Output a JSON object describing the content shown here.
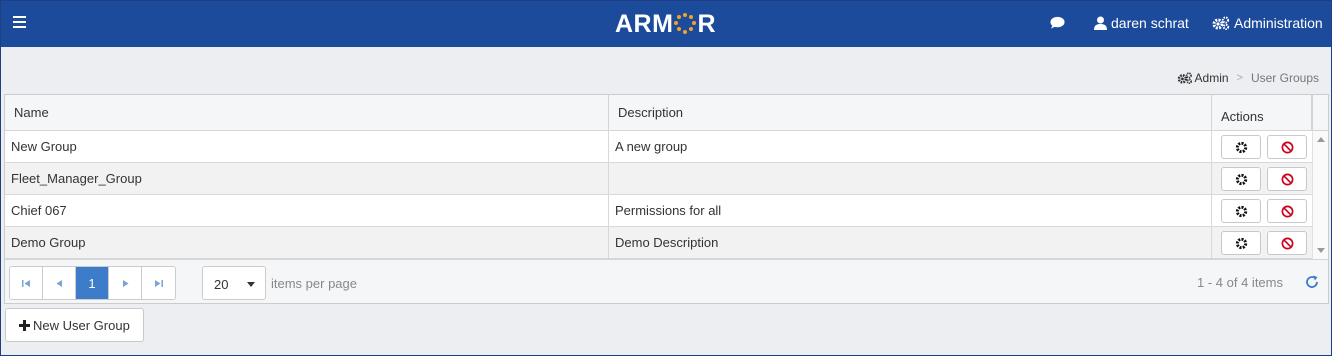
{
  "header": {
    "logo_text": "ARMOR",
    "user_name": "daren schrat",
    "admin_label": "Administration",
    "brand_color": "#1d4b9c",
    "logo_accent_color": "#f2a22b"
  },
  "breadcrumb": {
    "parent": "Admin",
    "separator": ">",
    "current": "User Groups"
  },
  "grid": {
    "columns": [
      "Name",
      "Description",
      "Actions"
    ],
    "rows": [
      {
        "name": "New Group",
        "description": "A new group"
      },
      {
        "name": "Fleet_Manager_Group",
        "description": ""
      },
      {
        "name": "Chief 067",
        "description": "Permissions for all"
      },
      {
        "name": "Demo Group",
        "description": "Demo Description"
      }
    ],
    "row_action_icons": [
      "gear-icon",
      "ban-icon"
    ]
  },
  "pager": {
    "current_page": "1",
    "page_size": "20",
    "items_per_page_label": "items per page",
    "info": "1 - 4 of 4 items",
    "active_color": "#3d7cc9"
  },
  "new_button": {
    "label": "New User Group"
  }
}
